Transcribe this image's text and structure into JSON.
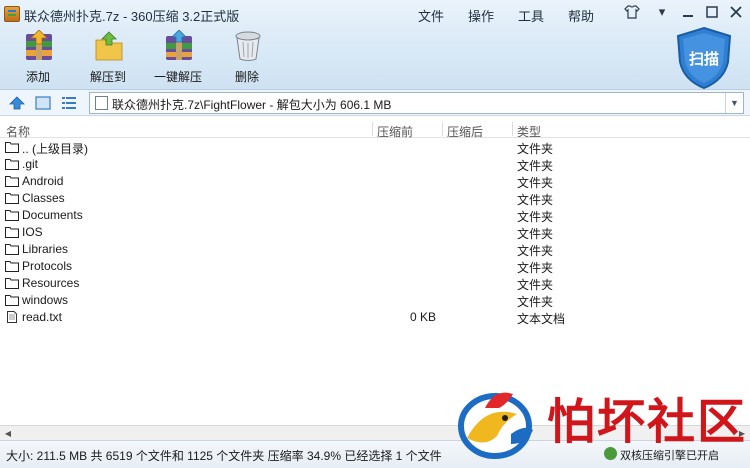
{
  "window": {
    "title": "联众德州扑克.7z - 360压缩 3.2正式版"
  },
  "menu": [
    "文件",
    "操作",
    "工具",
    "帮助"
  ],
  "toolbar": {
    "add": "添加",
    "extract_to": "解压到",
    "one_click_extract": "一键解压",
    "delete": "删除"
  },
  "scan": {
    "label": "扫描"
  },
  "address": {
    "path": "联众德州扑克.7z\\FightFlower - 解包大小为 606.1 MB"
  },
  "columns": {
    "name": "名称",
    "packed": "压缩前",
    "compressed": "压缩后",
    "type": "类型"
  },
  "rows": [
    {
      "name": ".. (上级目录)",
      "size": "",
      "type": "文件夹",
      "kind": "folder"
    },
    {
      "name": ".git",
      "size": "",
      "type": "文件夹",
      "kind": "folder"
    },
    {
      "name": "Android",
      "size": "",
      "type": "文件夹",
      "kind": "folder"
    },
    {
      "name": "Classes",
      "size": "",
      "type": "文件夹",
      "kind": "folder"
    },
    {
      "name": "Documents",
      "size": "",
      "type": "文件夹",
      "kind": "folder"
    },
    {
      "name": "IOS",
      "size": "",
      "type": "文件夹",
      "kind": "folder"
    },
    {
      "name": "Libraries",
      "size": "",
      "type": "文件夹",
      "kind": "folder"
    },
    {
      "name": "Protocols",
      "size": "",
      "type": "文件夹",
      "kind": "folder"
    },
    {
      "name": "Resources",
      "size": "",
      "type": "文件夹",
      "kind": "folder"
    },
    {
      "name": "windows",
      "size": "",
      "type": "文件夹",
      "kind": "folder"
    },
    {
      "name": "read.txt",
      "size": "0 KB",
      "type": "文本文档",
      "kind": "text"
    }
  ],
  "status": {
    "summary": "大小: 211.5 MB 共 6519 个文件和 1125 个文件夹 压缩率 34.9% 已经选择 1 个文件",
    "right": "双核压缩引擎已开启"
  },
  "watermark": {
    "text": "怕坏社区"
  }
}
